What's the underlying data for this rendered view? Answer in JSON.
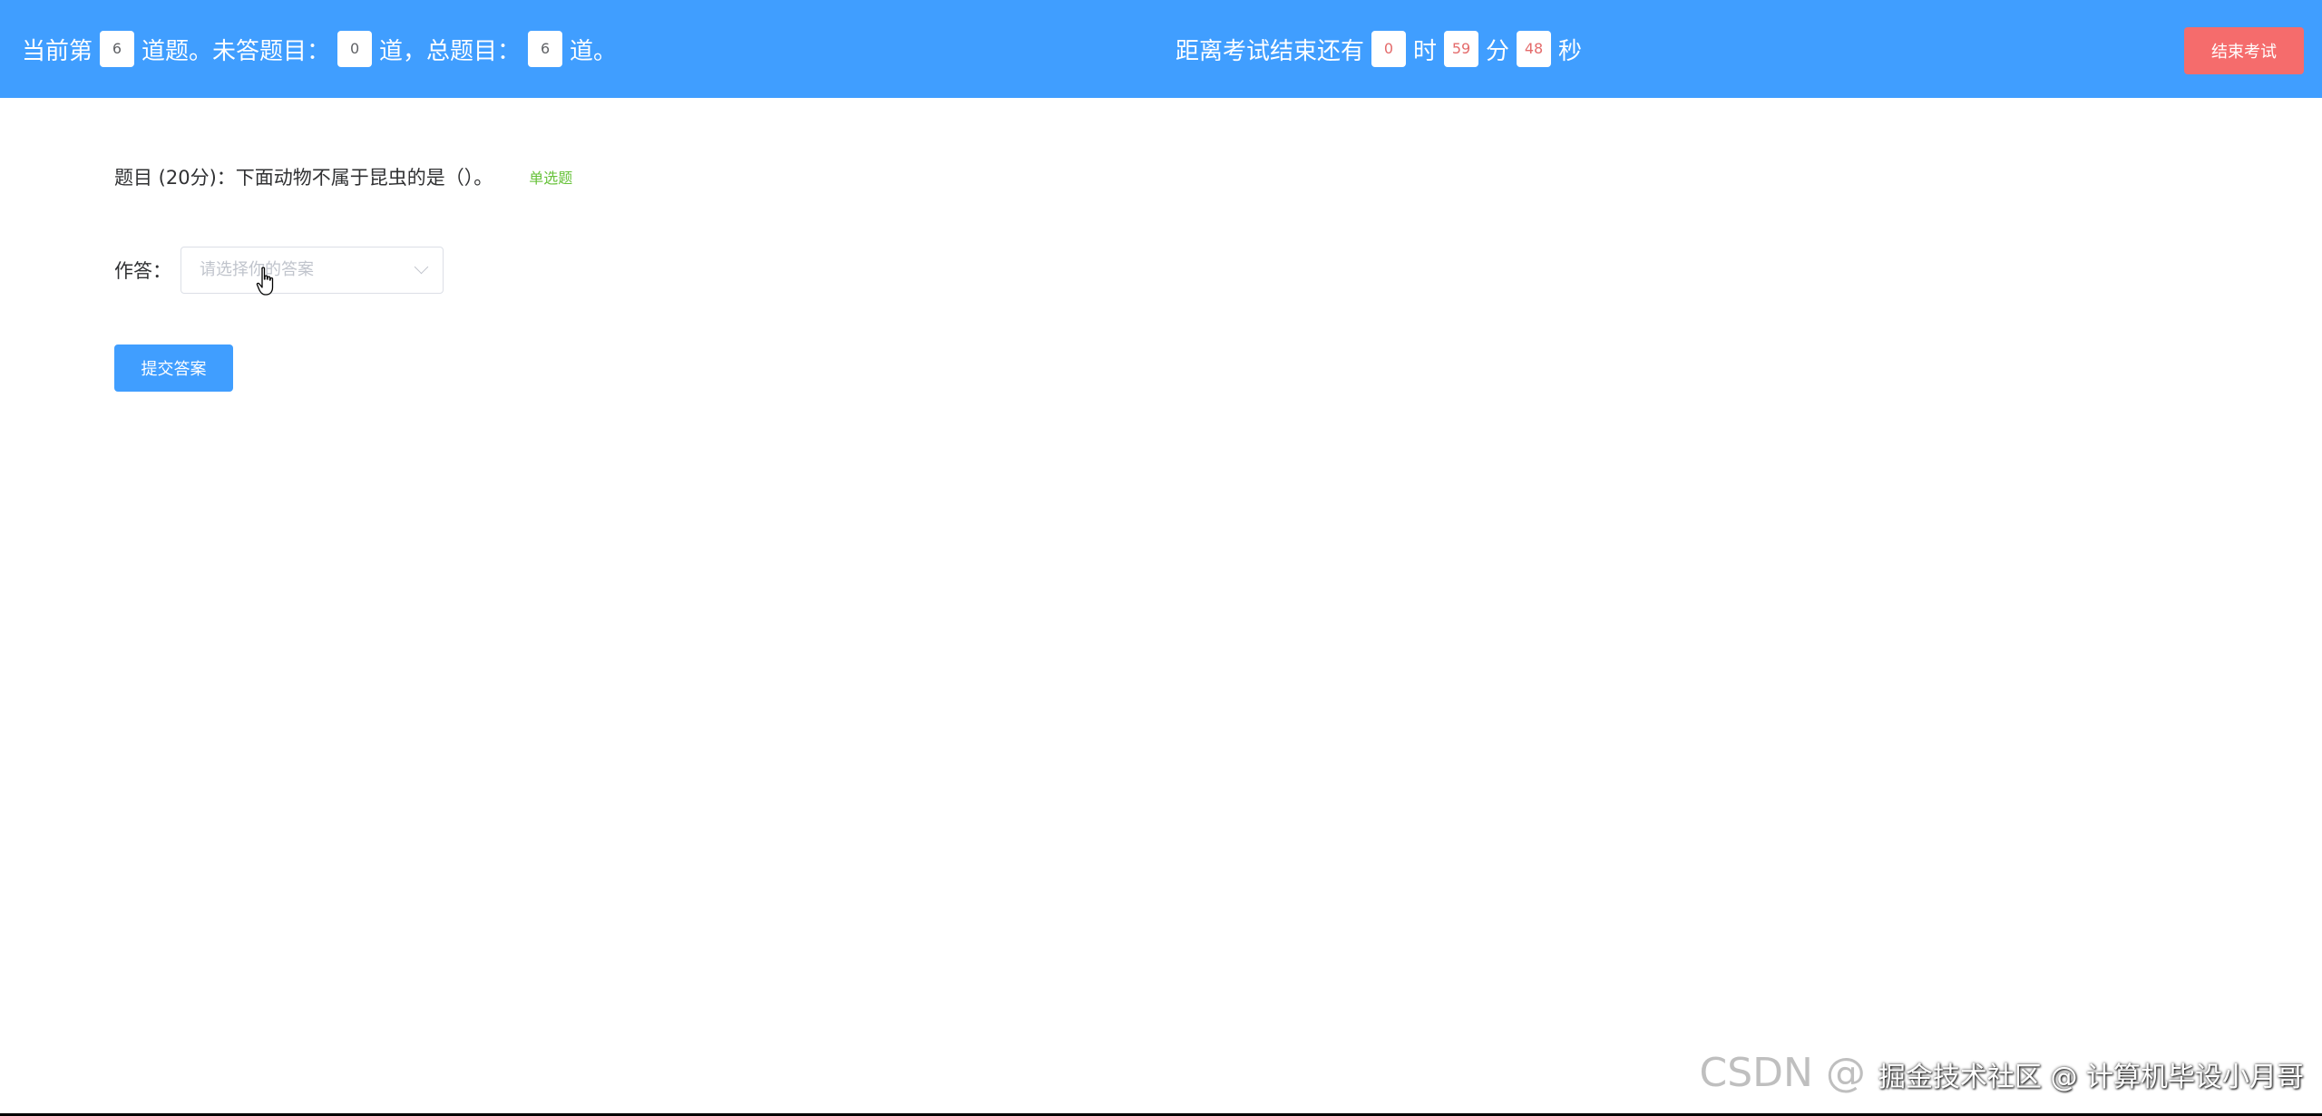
{
  "header": {
    "current_prefix": "当前第",
    "current_num": "6",
    "current_suffix": "道题。未答题目：",
    "unanswered_num": "0",
    "unanswered_suffix": "道，总题目：",
    "total_num": "6",
    "total_suffix": "道。",
    "timer_prefix": "距离考试结束还有",
    "hours": "0",
    "hours_unit": "时",
    "minutes": "59",
    "minutes_unit": "分",
    "seconds": "48",
    "seconds_unit": "秒",
    "end_button": "结束考试"
  },
  "question": {
    "text": "题目 (20分)：下面动物不属于昆虫的是（）。",
    "type": "单选题"
  },
  "answer": {
    "label": "作答：",
    "placeholder": "请选择你的答案"
  },
  "submit_button": "提交答案",
  "watermark": {
    "csdn": "CSDN @",
    "juejin": "掘金技术社区 @ 计算机毕设小月哥"
  },
  "colors": {
    "header_bg": "#409eff",
    "end_button_bg": "#f56c6c",
    "question_type": "#67c23a",
    "submit_bg": "#409eff"
  },
  "icons": [
    "chevron-down-icon",
    "hand-cursor-icon"
  ]
}
